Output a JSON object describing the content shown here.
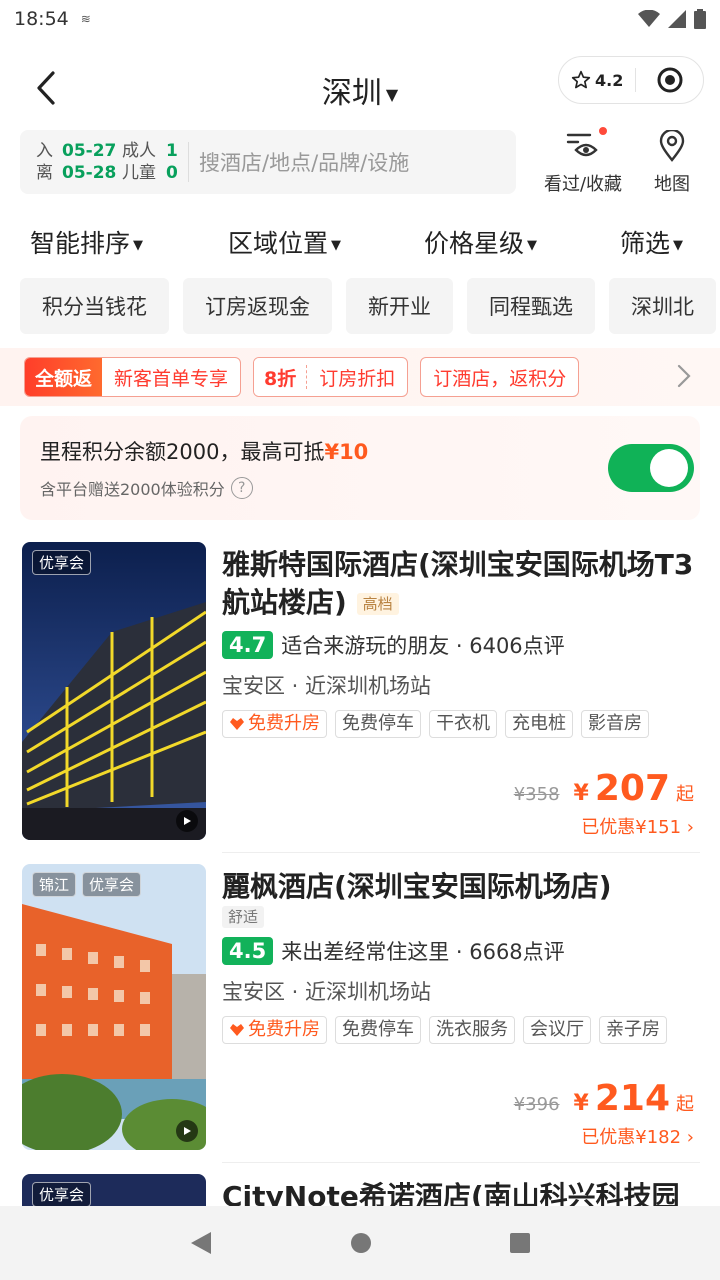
{
  "status_bar": {
    "time": "18:54",
    "extra": "≋"
  },
  "header": {
    "city": "深圳",
    "rating": "4.2"
  },
  "search": {
    "checkin_label": "入",
    "checkin_date": "05-27",
    "checkout_label": "离",
    "checkout_date": "05-28",
    "adult_label": "成人",
    "adult_count": "1",
    "child_label": "儿童",
    "child_count": "0",
    "placeholder": "搜酒店/地点/品牌/设施"
  },
  "actions": {
    "viewed_label": "看过/收藏",
    "map_label": "地图"
  },
  "sort": [
    {
      "label": "智能排序"
    },
    {
      "label": "区域位置"
    },
    {
      "label": "价格星级"
    },
    {
      "label": "筛选"
    }
  ],
  "chips": [
    "积分当钱花",
    "订房返现金",
    "新开业",
    "同程甄选",
    "深圳北"
  ],
  "promo": {
    "g1_tag": "全额返",
    "g1_text": "新客首单专享",
    "g2_tag": "8折",
    "g2_text": "订房折扣",
    "g3_text": "订酒店，返积分"
  },
  "points": {
    "line1_prefix": "里程积分余额2000，最高可抵",
    "line1_amount": "¥10",
    "line2": "含平台赠送2000体验积分",
    "toggle_on": true
  },
  "hotels": [
    {
      "tags": [
        "优享会"
      ],
      "name": "雅斯特国际酒店(深圳宝安国际机场T3航站楼店)",
      "grade": "高档",
      "score": "4.7",
      "review_text": "适合来游玩的朋友 · 6406点评",
      "location": "宝安区 · 近深圳机场站",
      "facilities": [
        "免费升房",
        "免费停车",
        "干衣机",
        "充电桩",
        "影音房"
      ],
      "orig_price": "¥358",
      "yen": "¥",
      "price": "207",
      "qi": "起",
      "saved": "已优惠¥151"
    },
    {
      "tags": [
        "锦江",
        "优享会"
      ],
      "name": "麗枫酒店(深圳宝安国际机场店)",
      "grade": "舒适",
      "score": "4.5",
      "review_text": "来出差经常住这里 · 6668点评",
      "location": "宝安区 · 近深圳机场站",
      "facilities": [
        "免费升房",
        "免费停车",
        "洗衣服务",
        "会议厅",
        "亲子房"
      ],
      "orig_price": "¥396",
      "yen": "¥",
      "price": "214",
      "qi": "起",
      "saved": "已优惠¥182"
    },
    {
      "tags": [
        "优享会"
      ],
      "name": "CityNote希诺酒店(南山科兴科技园"
    }
  ]
}
